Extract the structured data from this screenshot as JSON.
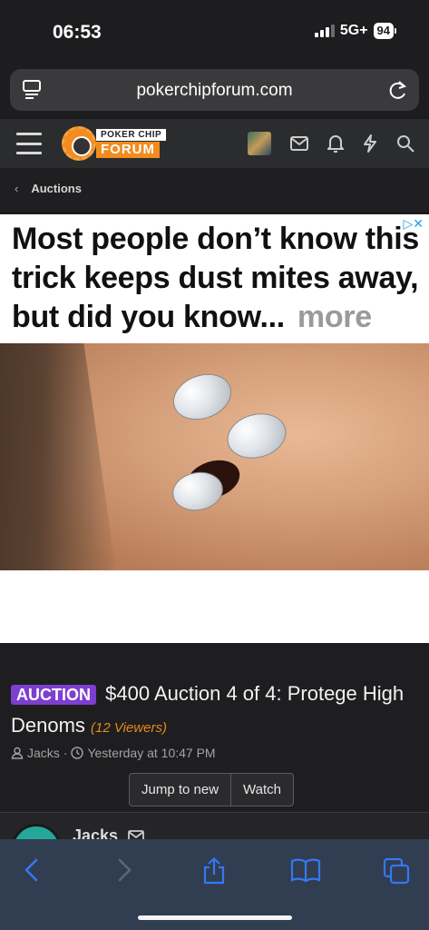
{
  "status_bar": {
    "time": "06:53",
    "network": "5G+",
    "battery": "94"
  },
  "browser": {
    "url": "pokerchipforum.com"
  },
  "site_header": {
    "logo_top": "POKER CHIP",
    "logo_bottom": "FORUM"
  },
  "breadcrumb": {
    "item": "Auctions"
  },
  "ad": {
    "headline": "Most people don’t know this trick keeps dust mites away, but did you know...",
    "more": "more",
    "choices": "▷✕"
  },
  "thread": {
    "prefix": "AUCTION",
    "title": "$400 Auction 4 of 4: Protege High Denoms",
    "viewers": "(12 Viewers)",
    "author": "Jacks",
    "separator": "·",
    "timestamp": "Yesterday at 10:47 PM",
    "buttons": {
      "jump": "Jump to new",
      "watch": "Watch"
    }
  },
  "post_peek": {
    "author": "Jacks"
  },
  "colors": {
    "prefix_purple": "#7d3fcf",
    "viewers_orange": "#e38a1d",
    "toolbar_blue": "#3478f6"
  },
  "toolbar": {
    "icons": [
      "back-icon",
      "forward-icon",
      "share-icon",
      "bookmarks-icon",
      "tabs-icon"
    ]
  }
}
